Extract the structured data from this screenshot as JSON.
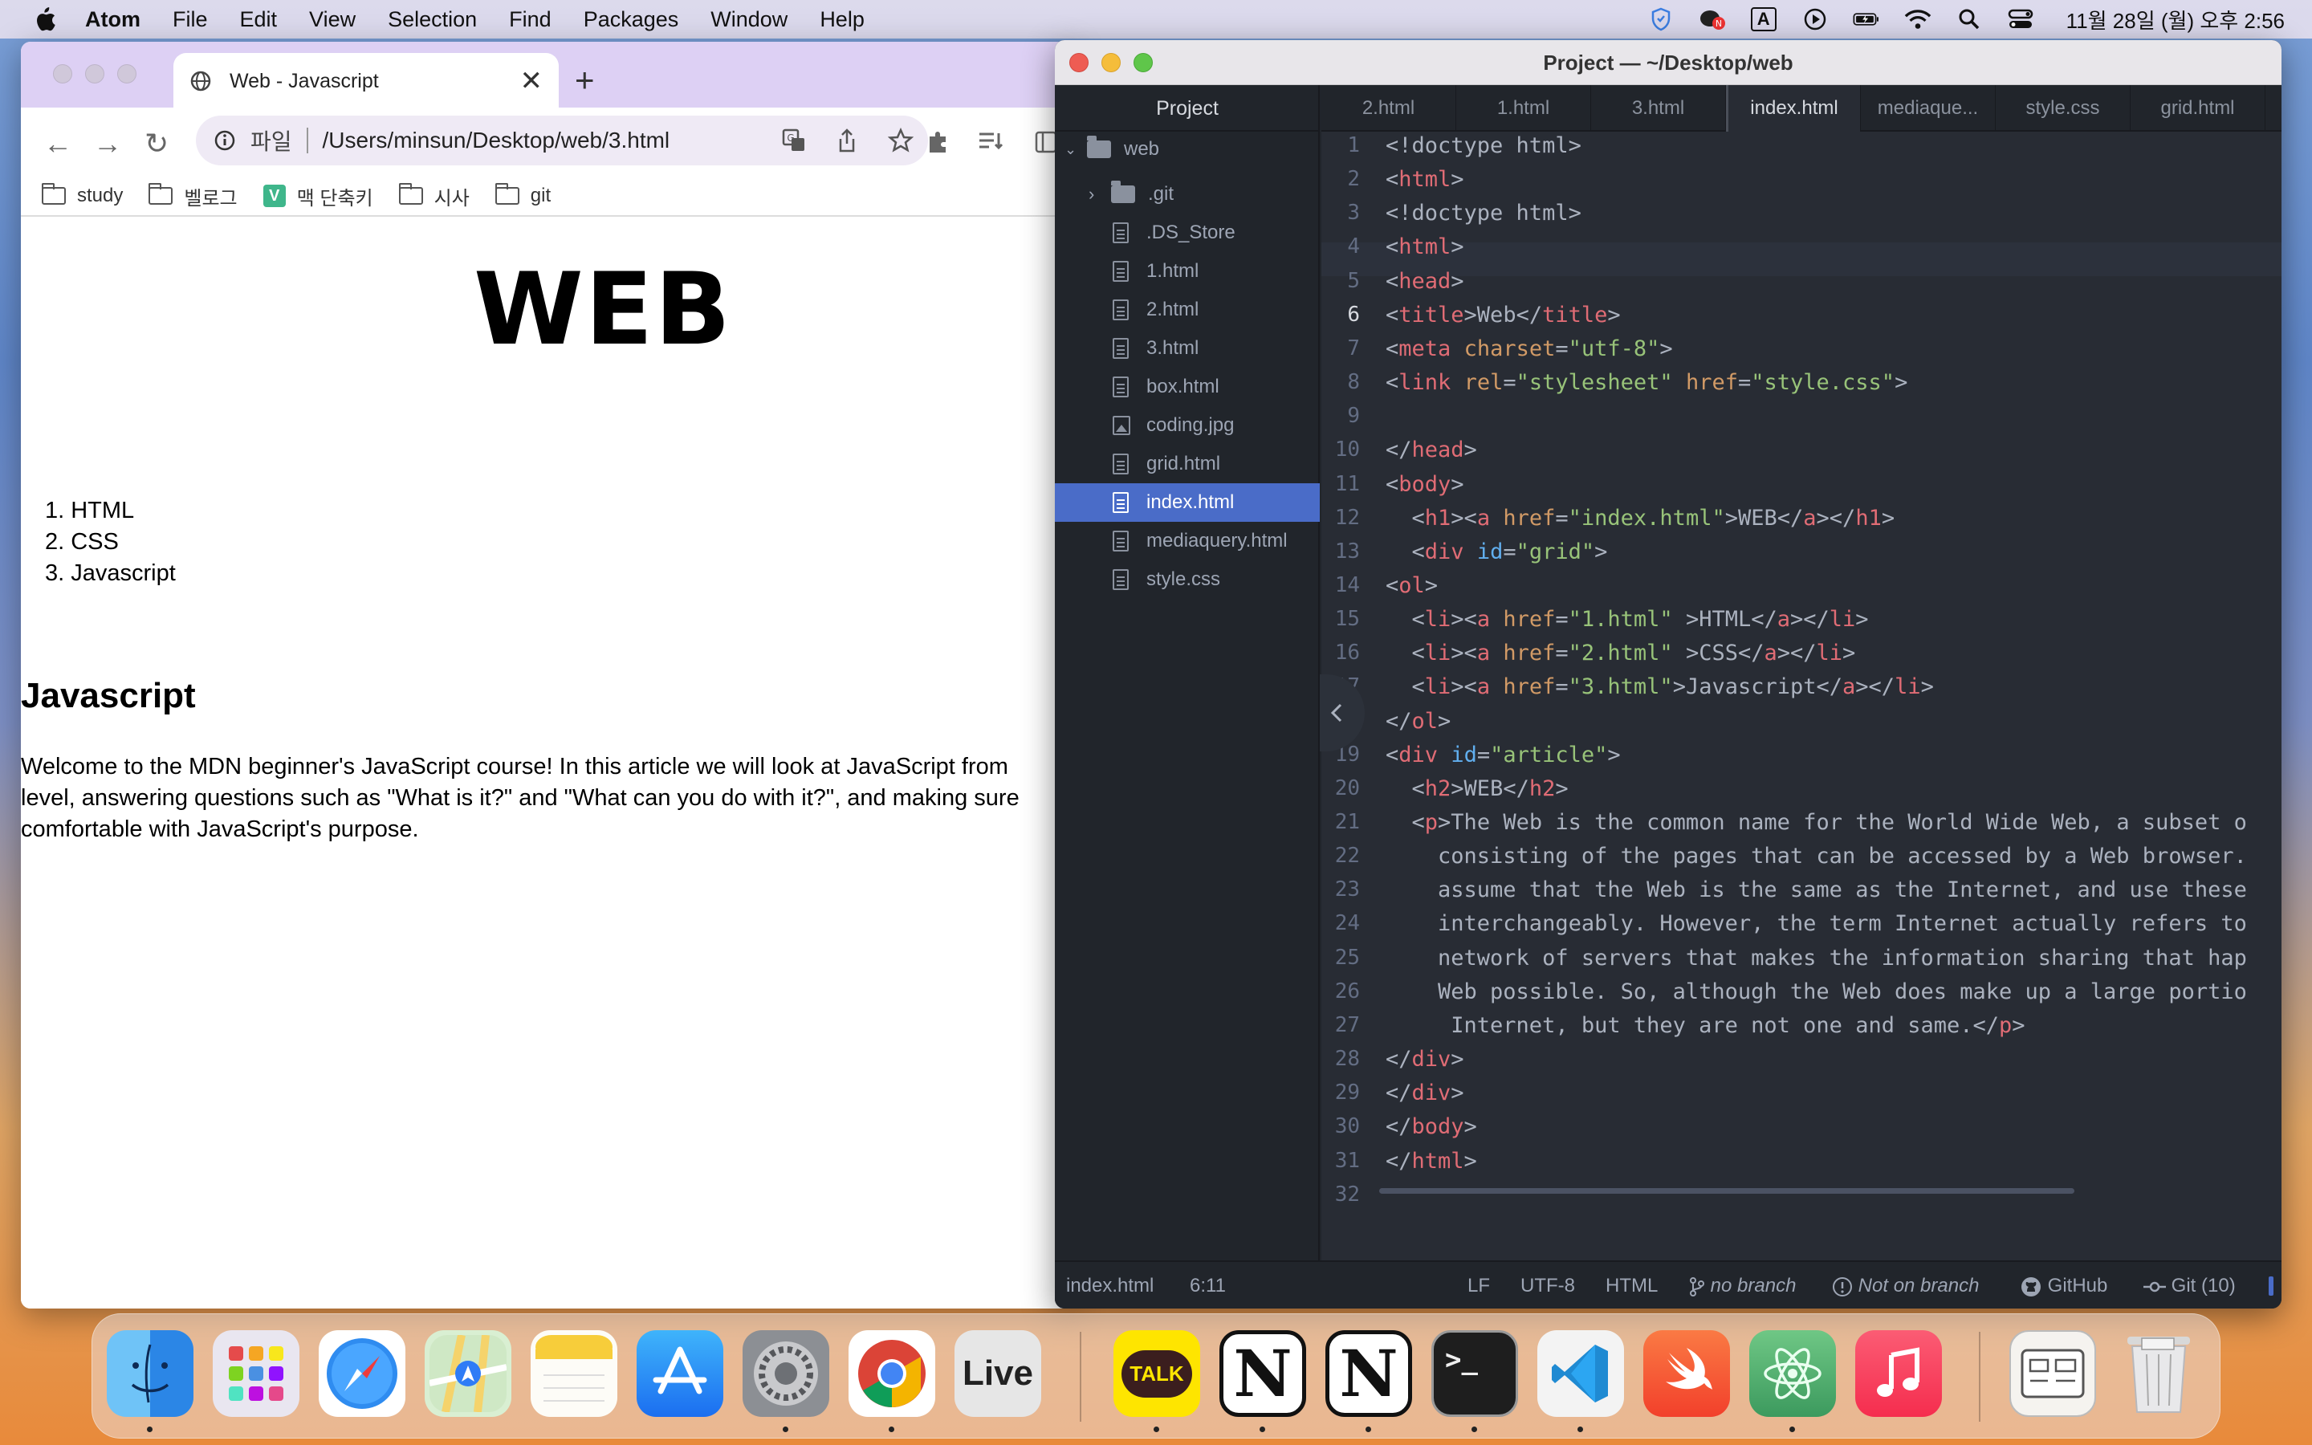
{
  "menubar": {
    "app": "Atom",
    "items": [
      "File",
      "Edit",
      "View",
      "Selection",
      "Find",
      "Packages",
      "Window",
      "Help"
    ],
    "input_source": "A",
    "clock": "11월 28일 (월) 오후 2:56"
  },
  "browser": {
    "tab_title": "Web - Javascript",
    "omnibox": {
      "scheme_label": "파일",
      "url": "/Users/minsun/Desktop/web/3.html"
    },
    "bookmarks": [
      "study",
      "벨로그",
      "맥 단축키",
      "시사",
      "git"
    ],
    "bookmark_badge": "V",
    "page": {
      "h1": "WEB",
      "list": [
        "1. HTML",
        "2. CSS",
        "3. Javascript"
      ],
      "h2": "Javascript",
      "paragraph_lines": [
        "Welcome to the MDN beginner's JavaScript course! In this article we will look at JavaScript from",
        "level, answering questions such as \"What is it?\" and \"What can you do with it?\", and making sure",
        "comfortable with JavaScript's purpose."
      ]
    }
  },
  "atom": {
    "title": "Project — ~/Desktop/web",
    "tree": {
      "header": "Project",
      "root": "web",
      "items": [
        {
          "name": ".git",
          "kind": "dir"
        },
        {
          "name": ".DS_Store",
          "kind": "file"
        },
        {
          "name": "1.html",
          "kind": "file"
        },
        {
          "name": "2.html",
          "kind": "file"
        },
        {
          "name": "3.html",
          "kind": "file"
        },
        {
          "name": "box.html",
          "kind": "file"
        },
        {
          "name": "coding.jpg",
          "kind": "image"
        },
        {
          "name": "grid.html",
          "kind": "file"
        },
        {
          "name": "index.html",
          "kind": "file",
          "selected": true
        },
        {
          "name": "mediaquery.html",
          "kind": "file"
        },
        {
          "name": "style.css",
          "kind": "file"
        }
      ]
    },
    "tabs": [
      "2.html",
      "1.html",
      "3.html",
      "index.html",
      "mediaque...",
      "style.css",
      "grid.html"
    ],
    "active_tab": "index.html",
    "line_numbers": [
      "1",
      "2",
      "3",
      "4",
      "5",
      "6",
      "7",
      "8",
      "9",
      "10",
      "11",
      "12",
      "13",
      "14",
      "15",
      "16",
      "17",
      "18",
      "19",
      "20",
      "21",
      "22",
      "23",
      "24",
      "25",
      "26",
      "27",
      "28",
      "29",
      "30",
      "31",
      "32"
    ],
    "code": [
      {
        "n": "1",
        "segs": [
          [
            "pt",
            "<!doctype html>"
          ]
        ]
      },
      {
        "n": "2",
        "segs": [
          [
            "pt",
            "<"
          ],
          [
            "tg",
            "html"
          ],
          [
            "pt",
            ">"
          ]
        ]
      },
      {
        "n": "3",
        "segs": [
          [
            "pt",
            "<!doctype html>"
          ]
        ]
      },
      {
        "n": "4",
        "segs": [
          [
            "pt",
            "<"
          ],
          [
            "tg",
            "html"
          ],
          [
            "pt",
            ">"
          ]
        ]
      },
      {
        "n": "5",
        "segs": [
          [
            "pt",
            "<"
          ],
          [
            "tg",
            "head"
          ],
          [
            "pt",
            ">"
          ]
        ]
      },
      {
        "n": "6",
        "segs": [
          [
            "pt",
            "<"
          ],
          [
            "tg",
            "title"
          ],
          [
            "pt",
            ">Web</"
          ],
          [
            "tg",
            "title"
          ],
          [
            "pt",
            ">"
          ]
        ]
      },
      {
        "n": "7",
        "segs": [
          [
            "pt",
            "<"
          ],
          [
            "tg",
            "meta"
          ],
          [
            "pt",
            " "
          ],
          [
            "at",
            "charset"
          ],
          [
            "pt",
            "="
          ],
          [
            "st",
            "\"utf-8\""
          ],
          [
            "pt",
            ">"
          ]
        ]
      },
      {
        "n": "8",
        "segs": [
          [
            "pt",
            "<"
          ],
          [
            "tg",
            "link"
          ],
          [
            "pt",
            " "
          ],
          [
            "at",
            "rel"
          ],
          [
            "pt",
            "="
          ],
          [
            "st",
            "\"stylesheet\""
          ],
          [
            "pt",
            " "
          ],
          [
            "at",
            "href"
          ],
          [
            "pt",
            "="
          ],
          [
            "st",
            "\"style.css\""
          ],
          [
            "pt",
            ">"
          ]
        ]
      },
      {
        "n": "9",
        "segs": []
      },
      {
        "n": "10",
        "segs": [
          [
            "pt",
            "</"
          ],
          [
            "tg",
            "head"
          ],
          [
            "pt",
            ">"
          ]
        ]
      },
      {
        "n": "11",
        "segs": [
          [
            "pt",
            "<"
          ],
          [
            "tg",
            "body"
          ],
          [
            "pt",
            ">"
          ]
        ]
      },
      {
        "n": "12",
        "segs": [
          [
            "pt",
            "  <"
          ],
          [
            "tg",
            "h1"
          ],
          [
            "pt",
            "><"
          ],
          [
            "tg",
            "a"
          ],
          [
            "pt",
            " "
          ],
          [
            "at",
            "href"
          ],
          [
            "pt",
            "="
          ],
          [
            "st",
            "\"index.html\""
          ],
          [
            "pt",
            ">WEB</"
          ],
          [
            "tg",
            "a"
          ],
          [
            "pt",
            "></"
          ],
          [
            "tg",
            "h1"
          ],
          [
            "pt",
            ">"
          ]
        ]
      },
      {
        "n": "13",
        "segs": [
          [
            "pt",
            "  <"
          ],
          [
            "tg",
            "div"
          ],
          [
            "pt",
            " "
          ],
          [
            "idn",
            "id"
          ],
          [
            "pt",
            "="
          ],
          [
            "st",
            "\"grid\""
          ],
          [
            "pt",
            ">"
          ]
        ]
      },
      {
        "n": "14",
        "segs": [
          [
            "pt",
            "<"
          ],
          [
            "tg",
            "ol"
          ],
          [
            "pt",
            ">"
          ]
        ]
      },
      {
        "n": "15",
        "segs": [
          [
            "pt",
            "  <"
          ],
          [
            "tg",
            "li"
          ],
          [
            "pt",
            "><"
          ],
          [
            "tg",
            "a"
          ],
          [
            "pt",
            " "
          ],
          [
            "at",
            "href"
          ],
          [
            "pt",
            "="
          ],
          [
            "st",
            "\"1.html\""
          ],
          [
            "pt",
            " >HTML</"
          ],
          [
            "tg",
            "a"
          ],
          [
            "pt",
            "></"
          ],
          [
            "tg",
            "li"
          ],
          [
            "pt",
            ">"
          ]
        ]
      },
      {
        "n": "16",
        "segs": [
          [
            "pt",
            "  <"
          ],
          [
            "tg",
            "li"
          ],
          [
            "pt",
            "><"
          ],
          [
            "tg",
            "a"
          ],
          [
            "pt",
            " "
          ],
          [
            "at",
            "href"
          ],
          [
            "pt",
            "="
          ],
          [
            "st",
            "\"2.html\""
          ],
          [
            "pt",
            " >CSS</"
          ],
          [
            "tg",
            "a"
          ],
          [
            "pt",
            "></"
          ],
          [
            "tg",
            "li"
          ],
          [
            "pt",
            ">"
          ]
        ]
      },
      {
        "n": "17",
        "segs": [
          [
            "pt",
            "  <"
          ],
          [
            "tg",
            "li"
          ],
          [
            "pt",
            "><"
          ],
          [
            "tg",
            "a"
          ],
          [
            "pt",
            " "
          ],
          [
            "at",
            "href"
          ],
          [
            "pt",
            "="
          ],
          [
            "st",
            "\"3.html\""
          ],
          [
            "pt",
            ">Javascript</"
          ],
          [
            "tg",
            "a"
          ],
          [
            "pt",
            "></"
          ],
          [
            "tg",
            "li"
          ],
          [
            "pt",
            ">"
          ]
        ]
      },
      {
        "n": "18",
        "segs": [
          [
            "pt",
            "</"
          ],
          [
            "tg",
            "ol"
          ],
          [
            "pt",
            ">"
          ]
        ]
      },
      {
        "n": "19",
        "segs": [
          [
            "pt",
            "<"
          ],
          [
            "tg",
            "div"
          ],
          [
            "pt",
            " "
          ],
          [
            "idn",
            "id"
          ],
          [
            "pt",
            "="
          ],
          [
            "st",
            "\"article\""
          ],
          [
            "pt",
            ">"
          ]
        ]
      },
      {
        "n": "20",
        "segs": [
          [
            "pt",
            "  <"
          ],
          [
            "tg",
            "h2"
          ],
          [
            "pt",
            ">WEB</"
          ],
          [
            "tg",
            "h2"
          ],
          [
            "pt",
            ">"
          ]
        ]
      },
      {
        "n": "21",
        "segs": [
          [
            "pt",
            "  <"
          ],
          [
            "tg",
            "p"
          ],
          [
            "pt",
            ">The Web is the common name for the World Wide Web, a subset o"
          ]
        ]
      },
      {
        "n": "22",
        "segs": [
          [
            "pt",
            "    consisting of the pages that can be accessed by a Web browser."
          ]
        ]
      },
      {
        "n": "23",
        "segs": [
          [
            "pt",
            "    assume that the Web is the same as the Internet, and use these"
          ]
        ]
      },
      {
        "n": "24",
        "segs": [
          [
            "pt",
            "    interchangeably. However, the term Internet actually refers to"
          ]
        ]
      },
      {
        "n": "25",
        "segs": [
          [
            "pt",
            "    network of servers that makes the information sharing that hap"
          ]
        ]
      },
      {
        "n": "26",
        "segs": [
          [
            "pt",
            "    Web possible. So, although the Web does make up a large portio"
          ]
        ]
      },
      {
        "n": "27",
        "segs": [
          [
            "pt",
            "     Internet, but they are not one and same.</"
          ],
          [
            "tg",
            "p"
          ],
          [
            "pt",
            ">"
          ]
        ]
      },
      {
        "n": "28",
        "segs": [
          [
            "pt",
            "</"
          ],
          [
            "tg",
            "div"
          ],
          [
            "pt",
            ">"
          ]
        ]
      },
      {
        "n": "29",
        "segs": [
          [
            "pt",
            "</"
          ],
          [
            "tg",
            "div"
          ],
          [
            "pt",
            ">"
          ]
        ]
      },
      {
        "n": "30",
        "segs": [
          [
            "pt",
            "</"
          ],
          [
            "tg",
            "body"
          ],
          [
            "pt",
            ">"
          ]
        ]
      },
      {
        "n": "31",
        "segs": [
          [
            "pt",
            "</"
          ],
          [
            "tg",
            "html"
          ],
          [
            "pt",
            ">"
          ]
        ]
      },
      {
        "n": "32",
        "segs": []
      }
    ],
    "status": {
      "file": "index.html",
      "cursor": "6:11",
      "line_ending": "LF",
      "encoding": "UTF-8",
      "grammar": "HTML",
      "branch": "no branch",
      "branch_state": "Not on branch",
      "github": "GitHub",
      "git": "Git (10)"
    }
  },
  "dock": {
    "apps": [
      "finder-icon",
      "launchpad-icon",
      "safari-icon",
      "maps-icon",
      "notes-icon",
      "app-store-icon",
      "system-preferences-icon",
      "chrome-icon",
      "live-server-icon",
      "kakaotalk-icon",
      "notion-icon",
      "notion-icon-2",
      "terminal-icon",
      "vscode-icon",
      "swift-playgrounds-icon",
      "atom-icon",
      "music-icon",
      "downloads-stack-icon",
      "trash-icon"
    ],
    "labels": {
      "live": "Live",
      "talk": "TALK",
      "notion": "N"
    }
  },
  "colors": {
    "tag": "#e06c75",
    "attr": "#d19a66",
    "string": "#98c379",
    "id_attr": "#61afef",
    "selection": "#4a6cc8"
  }
}
